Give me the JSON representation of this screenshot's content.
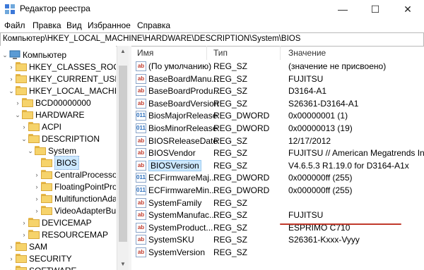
{
  "window": {
    "title": "Редактор реестра",
    "minimize_glyph": "—",
    "maximize_glyph": "☐",
    "close_glyph": "✕"
  },
  "menu": [
    "Файл",
    "Правка",
    "Вид",
    "Избранное",
    "Справка"
  ],
  "address": "Компьютер\\HKEY_LOCAL_MACHINE\\HARDWARE\\DESCRIPTION\\System\\BIOS",
  "tree": [
    {
      "label": "Компьютер",
      "exp": "⌄",
      "icon": "computer"
    },
    {
      "label": "HKEY_CLASSES_ROOT",
      "exp": "›",
      "icon": "folder"
    },
    {
      "label": "HKEY_CURRENT_USER",
      "exp": "›",
      "icon": "folder"
    },
    {
      "label": "HKEY_LOCAL_MACHINE",
      "exp": "⌄",
      "icon": "folder"
    },
    {
      "label": "BCD00000000",
      "exp": "›",
      "icon": "folder"
    },
    {
      "label": "HARDWARE",
      "exp": "⌄",
      "icon": "folder"
    },
    {
      "label": "ACPI",
      "exp": "›",
      "icon": "folder"
    },
    {
      "label": "DESCRIPTION",
      "exp": "⌄",
      "icon": "folder"
    },
    {
      "label": "System",
      "exp": "⌄",
      "icon": "folder"
    },
    {
      "label": "BIOS",
      "exp": "",
      "icon": "folder",
      "selected": true
    },
    {
      "label": "CentralProcessor",
      "exp": "›",
      "icon": "folder"
    },
    {
      "label": "FloatingPointPro",
      "exp": "›",
      "icon": "folder"
    },
    {
      "label": "MultifunctionAda",
      "exp": "›",
      "icon": "folder"
    },
    {
      "label": "VideoAdapterBus",
      "exp": "›",
      "icon": "folder"
    },
    {
      "label": "DEVICEMAP",
      "exp": "›",
      "icon": "folder"
    },
    {
      "label": "RESOURCEMAP",
      "exp": "›",
      "icon": "folder"
    },
    {
      "label": "SAM",
      "exp": "›",
      "icon": "folder"
    },
    {
      "label": "SECURITY",
      "exp": "›",
      "icon": "folder"
    },
    {
      "label": "SOFTWARE",
      "exp": "›",
      "icon": "folder"
    }
  ],
  "columns": {
    "name": "Имя",
    "type": "Тип",
    "value": "Значение"
  },
  "values": [
    {
      "name": "(По умолчанию)",
      "type": "REG_SZ",
      "data": "(значение не присвоено)",
      "icon": "sz"
    },
    {
      "name": "BaseBoardManu...",
      "type": "REG_SZ",
      "data": "FUJITSU",
      "icon": "sz"
    },
    {
      "name": "BaseBoardProdu...",
      "type": "REG_SZ",
      "data": "D3164-A1",
      "icon": "sz"
    },
    {
      "name": "BaseBoardVersion",
      "type": "REG_SZ",
      "data": "S26361-D3164-A1",
      "icon": "sz"
    },
    {
      "name": "BiosMajorRelease",
      "type": "REG_DWORD",
      "data": "0x00000001 (1)",
      "icon": "dw"
    },
    {
      "name": "BiosMinorRelease",
      "type": "REG_DWORD",
      "data": "0x00000013 (19)",
      "icon": "dw"
    },
    {
      "name": "BIOSReleaseDate",
      "type": "REG_SZ",
      "data": "12/17/2012",
      "icon": "sz"
    },
    {
      "name": "BIOSVendor",
      "type": "REG_SZ",
      "data": "FUJITSU // American Megatrends Inc.",
      "icon": "sz"
    },
    {
      "name": "BIOSVersion",
      "type": "REG_SZ",
      "data": "V4.6.5.3 R1.19.0 for D3164-A1x",
      "icon": "sz",
      "selected": true
    },
    {
      "name": "ECFirmwareMaj...",
      "type": "REG_DWORD",
      "data": "0x000000ff (255)",
      "icon": "dw"
    },
    {
      "name": "ECFirmwareMin...",
      "type": "REG_DWORD",
      "data": "0x000000ff (255)",
      "icon": "dw"
    },
    {
      "name": "SystemFamily",
      "type": "REG_SZ",
      "data": "",
      "icon": "sz"
    },
    {
      "name": "SystemManufac...",
      "type": "REG_SZ",
      "data": "FUJITSU",
      "icon": "sz"
    },
    {
      "name": "SystemProduct...",
      "type": "REG_SZ",
      "data": "ESPRIMO C710",
      "icon": "sz"
    },
    {
      "name": "SystemSKU",
      "type": "REG_SZ",
      "data": "S26361-Kxxx-Vyyy",
      "icon": "sz"
    },
    {
      "name": "SystemVersion",
      "type": "REG_SZ",
      "data": "",
      "icon": "sz"
    }
  ],
  "icon_text": {
    "sz": "ab",
    "dw": "011"
  },
  "colors": {
    "selection": "#cce8ff",
    "highlight_underline": "#c0392b",
    "folder": "#f6d36b"
  }
}
